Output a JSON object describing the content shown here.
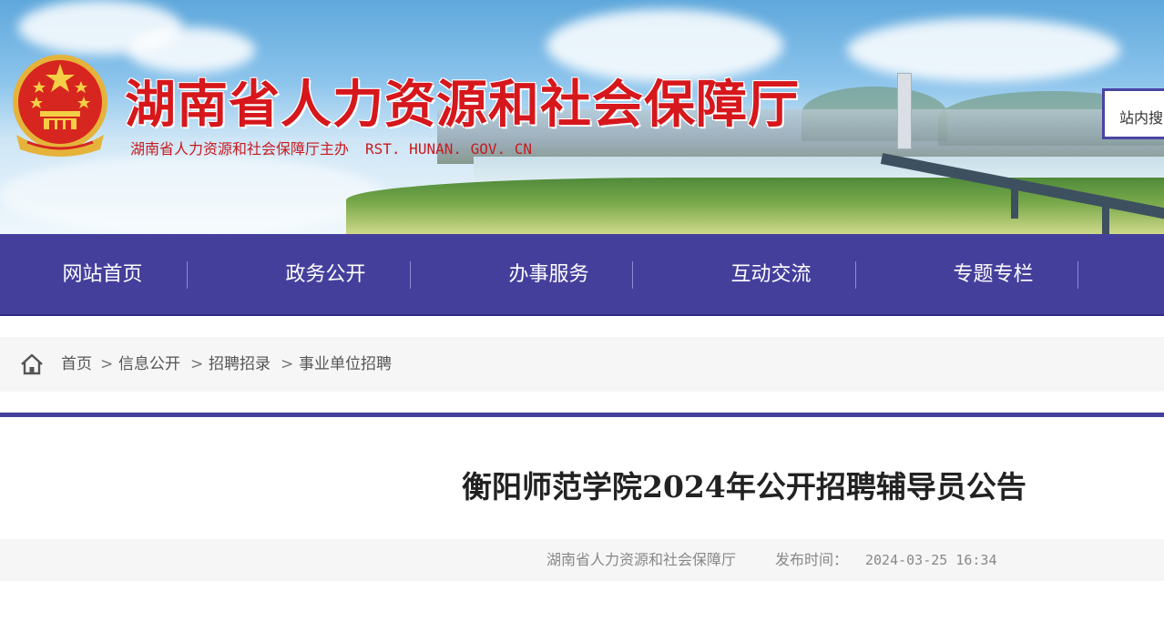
{
  "banner": {
    "title": "湖南省人力资源和社会保障厅",
    "subtitle": "湖南省人力资源和社会保障厅主办",
    "domain": "RST. HUNAN. GOV. CN",
    "search_placeholder": "站内搜",
    "emblem_icon": "national-emblem-icon",
    "title_color": "#d6171c"
  },
  "nav": {
    "items": [
      "网站首页",
      "政务公开",
      "办事服务",
      "互动交流",
      "专题专栏"
    ],
    "background": "#453f9c"
  },
  "breadcrumb": {
    "home_icon": "home-icon",
    "items": [
      "首页",
      "信息公开",
      "招聘招录",
      "事业单位招聘"
    ],
    "separator": ">"
  },
  "article": {
    "title": "衡阳师范学院2024年公开招聘辅导员公告",
    "source": "湖南省人力资源和社会保障厅",
    "date_label": "发布时间：",
    "date": "2024-03-25 16:34"
  }
}
